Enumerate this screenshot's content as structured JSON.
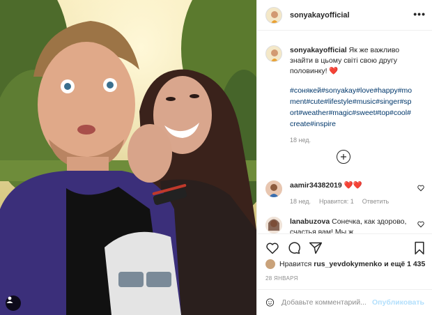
{
  "post": {
    "author": "sonyakayofficial",
    "caption": "Як же важливо знайти в цьому світі свою другу половинку!",
    "caption_emoji": "❤️",
    "hashtags": "#сонякей#sonyakay#love#happy#moment#cute#lifestyle#music#singer#sport#weather#magic#sweet#top#cool#create#inspire",
    "time": "18 нед.",
    "date": "28 ЯНВАРЯ"
  },
  "comments": [
    {
      "user": "aamir34382019",
      "text": "❤️❤️",
      "time": "18 нед.",
      "likes_label": "Нравится: 1",
      "reply_label": "Ответить"
    },
    {
      "user": "lanabuzova",
      "text": "Сонечка, как здорово, счастья вам! Мы ж"
    }
  ],
  "likes": {
    "prefix": "Нравится",
    "user": "rus_yevdokymenko",
    "suffix": "и ещё 1 435"
  },
  "composer": {
    "placeholder": "Добавьте комментарий...",
    "publish_label": "Опубликовать"
  },
  "icons": {
    "more": "more-options-icon",
    "load_more": "plus-circle-icon",
    "like": "heart-icon",
    "comment": "comment-icon",
    "share": "share-icon",
    "save": "bookmark-icon",
    "emoji": "smiley-icon",
    "tagged": "user-tag-icon"
  },
  "colors": {
    "link": "#00376b",
    "muted": "#8e8e8e",
    "heart": "#ed4956",
    "publish": "#b2dffc"
  }
}
